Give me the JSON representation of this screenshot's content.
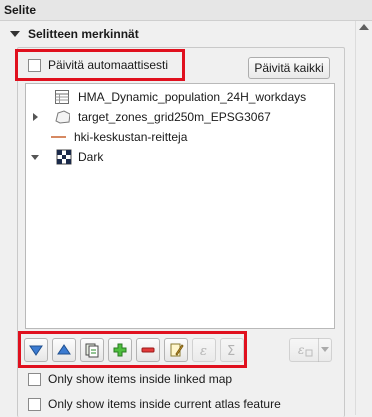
{
  "panel": {
    "title": "Selite"
  },
  "section": {
    "title": "Selitteen merkinnät"
  },
  "auto_update": {
    "label": "Päivitä automaattisesti",
    "checked": false
  },
  "update_all_button": {
    "label": "Päivitä kaikki"
  },
  "legend_items": [
    {
      "label": "HMA_Dynamic_population_24H_workdays",
      "icon": "raster-table-icon"
    },
    {
      "label": "target_zones_grid250m_EPSG3067",
      "icon": "polygon-layer-icon"
    },
    {
      "label": "hki-keskustan-reitteja",
      "icon": "line-layer-icon"
    },
    {
      "label": "Dark",
      "icon": "checker-raster-icon"
    }
  ],
  "toolbar": {
    "buttons": [
      {
        "name": "move-down-icon",
        "label": "Move down"
      },
      {
        "name": "move-up-icon",
        "label": "Move up"
      },
      {
        "name": "add-group-icon",
        "label": "Add group"
      },
      {
        "name": "add-item-icon",
        "label": "Add item"
      },
      {
        "name": "remove-item-icon",
        "label": "Remove item"
      },
      {
        "name": "edit-item-icon",
        "label": "Edit item"
      },
      {
        "name": "expression-icon",
        "label": "Expression"
      },
      {
        "name": "sum-icon",
        "label": "Count"
      }
    ],
    "side_button": {
      "name": "expression-filter-icon"
    }
  },
  "options": [
    {
      "label": "Only show items inside linked map",
      "checked": false
    },
    {
      "label": "Only show items inside current atlas feature",
      "checked": false
    }
  ],
  "colors": {
    "highlight": "#e0101e",
    "accent_blue": "#2f6fb4"
  }
}
